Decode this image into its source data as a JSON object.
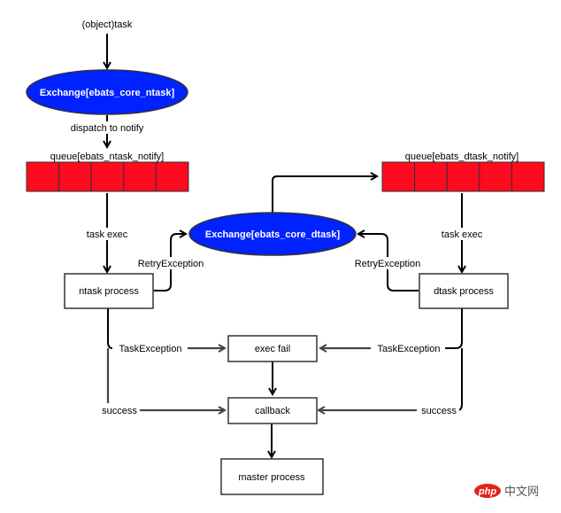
{
  "diagram": {
    "input_label": "(object)task",
    "exchange_ntask": "Exchange[ebats_core_ntask]",
    "dispatch_label": "dispatch to notify",
    "queue_ntask": "queue[ebats_ntask_notify]",
    "queue_dtask": "queue[ebats_dtask_notify]",
    "exchange_dtask": "Exchange[ebats_core_dtask]",
    "task_exec_left": "task exec",
    "task_exec_right": "task exec",
    "retry_left": "RetryException",
    "retry_right": "RetryException",
    "ntask_process": "ntask process",
    "dtask_process": "dtask process",
    "task_exception_left": "TaskException",
    "task_exception_right": "TaskException",
    "exec_fail": "exec fail",
    "success_left": "success",
    "success_right": "success",
    "callback": "callback",
    "master_process": "master process",
    "queue_cells": 5,
    "colors": {
      "exchange_fill": "#0022ff",
      "queue_fill": "#ff0a1e",
      "watermark_red": "#e2231a",
      "watermark_gray": "#555555"
    }
  },
  "watermark": {
    "brand": "php",
    "suffix": "中文网"
  }
}
